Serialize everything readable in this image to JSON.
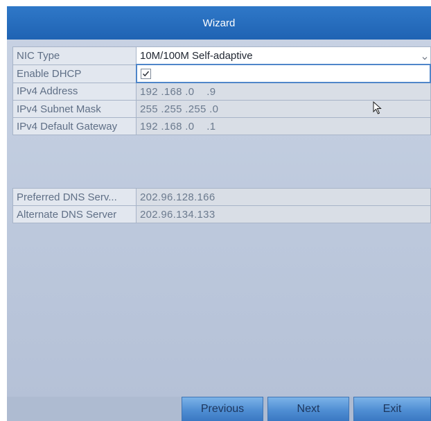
{
  "window": {
    "title": "Wizard"
  },
  "network": {
    "nic_type_label": "NIC Type",
    "nic_type_value": "10M/100M Self-adaptive",
    "enable_dhcp_label": "Enable DHCP",
    "enable_dhcp_checked": true,
    "ipv4_address_label": "IPv4 Address",
    "ipv4_address_value": "192 .168 .0    .9",
    "ipv4_subnet_mask_label": "IPv4 Subnet Mask",
    "ipv4_subnet_mask_value": "255 .255 .255 .0",
    "ipv4_gateway_label": "IPv4 Default Gateway",
    "ipv4_gateway_value": "192 .168 .0    .1"
  },
  "dns": {
    "preferred_label": "Preferred DNS Serv...",
    "preferred_value": "202.96.128.166",
    "alternate_label": "Alternate DNS Server",
    "alternate_value": "202.96.134.133"
  },
  "buttons": {
    "previous": "Previous",
    "next": "Next",
    "exit": "Exit"
  },
  "icons": {
    "dropdown": "chevron-down-icon",
    "checkbox": "checkmark-icon",
    "cursor": "mouse-pointer-icon"
  },
  "colors": {
    "titlebar": "#2169b9",
    "panel": "#c3cde0",
    "button": "#4f8ed3",
    "focus_border": "#4f86c9"
  }
}
